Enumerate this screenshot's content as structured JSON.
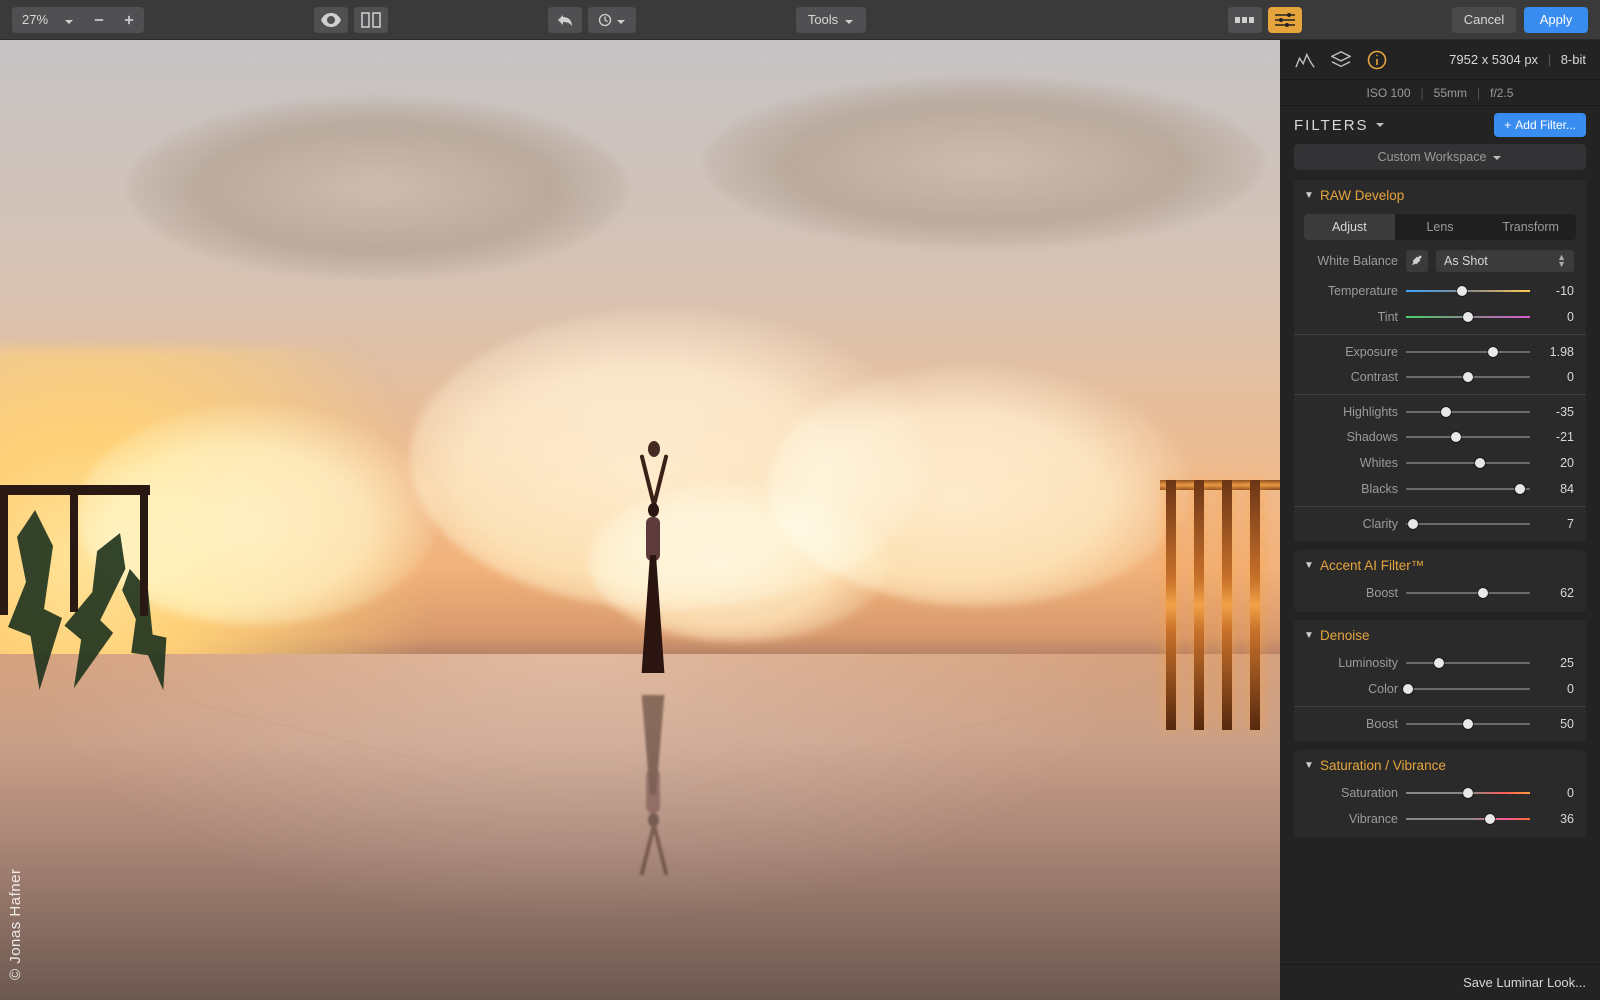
{
  "toolbar": {
    "zoom": "27%",
    "tools_label": "Tools",
    "cancel": "Cancel",
    "apply": "Apply"
  },
  "image": {
    "credit": "© Jonas Hafner",
    "dimensions": "7952 x 5304 px",
    "bitdepth": "8-bit",
    "iso": "ISO 100",
    "focal": "55mm",
    "aperture": "f/2.5"
  },
  "panel": {
    "filters_title": "FILTERS",
    "add_filter": "Add Filter...",
    "workspace": "Custom Workspace",
    "save_look": "Save Luminar Look..."
  },
  "raw": {
    "title": "RAW Develop",
    "tabs": {
      "adjust": "Adjust",
      "lens": "Lens",
      "transform": "Transform"
    },
    "wb_label": "White Balance",
    "wb_value": "As Shot",
    "sliders": {
      "temperature": {
        "label": "Temperature",
        "value": "-10",
        "pos": 45
      },
      "tint": {
        "label": "Tint",
        "value": "0",
        "pos": 50
      },
      "exposure": {
        "label": "Exposure",
        "value": "1.98",
        "pos": 70
      },
      "contrast": {
        "label": "Contrast",
        "value": "0",
        "pos": 50
      },
      "highlights": {
        "label": "Highlights",
        "value": "-35",
        "pos": 32
      },
      "shadows": {
        "label": "Shadows",
        "value": "-21",
        "pos": 40
      },
      "whites": {
        "label": "Whites",
        "value": "20",
        "pos": 60
      },
      "blacks": {
        "label": "Blacks",
        "value": "84",
        "pos": 92
      },
      "clarity": {
        "label": "Clarity",
        "value": "7",
        "pos": 6
      }
    }
  },
  "accent": {
    "title": "Accent AI Filter™",
    "boost": {
      "label": "Boost",
      "value": "62",
      "pos": 62
    }
  },
  "denoise": {
    "title": "Denoise",
    "luminosity": {
      "label": "Luminosity",
      "value": "25",
      "pos": 27
    },
    "color": {
      "label": "Color",
      "value": "0",
      "pos": 2
    },
    "boost": {
      "label": "Boost",
      "value": "50",
      "pos": 50
    }
  },
  "satvib": {
    "title": "Saturation / Vibrance",
    "saturation": {
      "label": "Saturation",
      "value": "0",
      "pos": 50
    },
    "vibrance": {
      "label": "Vibrance",
      "value": "36",
      "pos": 68
    }
  }
}
